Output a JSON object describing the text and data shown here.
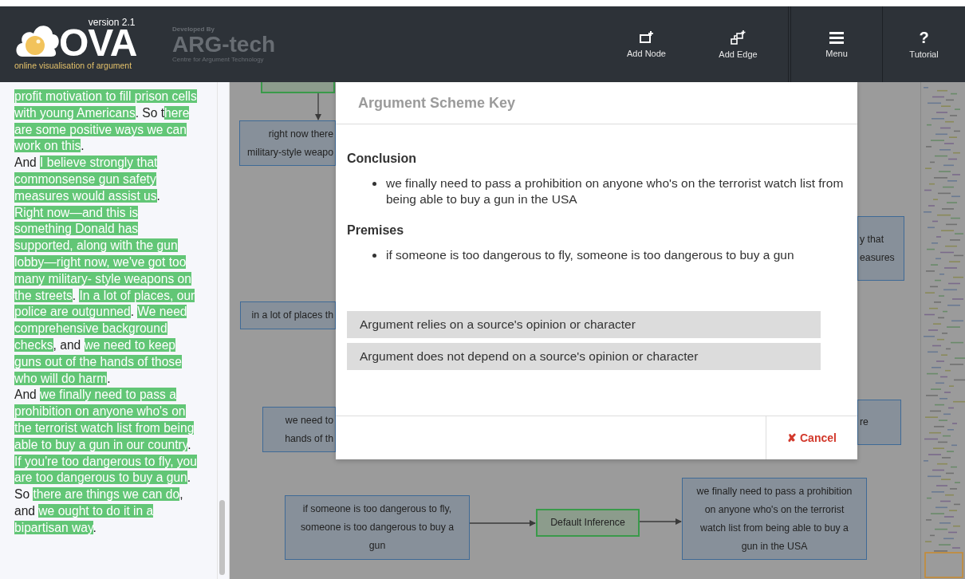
{
  "header": {
    "version": "version 2.1",
    "logo_text": "OVA",
    "tagline": "online visualisation of argument",
    "developer": {
      "label": "Developed By",
      "name": "ARG-tech",
      "subtitle": "Centre for Argument Technology"
    },
    "actions": [
      {
        "kind": "add-node",
        "label": "Add Node"
      },
      {
        "kind": "add-edge",
        "label": "Add Edge"
      },
      {
        "kind": "menu",
        "label": "Menu"
      },
      {
        "kind": "tutorial",
        "label": "Tutorial",
        "glyph": "?"
      }
    ]
  },
  "transcript": {
    "segments": [
      {
        "text": "profit motivation to fill prison cells with young Americans",
        "highlighted": true
      },
      {
        "text": ". So t",
        "highlighted": false
      },
      {
        "text": "here are some positive ways we can work on this",
        "highlighted": true
      },
      {
        "text": ".\nAnd ",
        "highlighted": false
      },
      {
        "text": "I believe strongly that commonsense gun safety measures would assist us",
        "highlighted": true
      },
      {
        "text": ".\n",
        "highlighted": false
      },
      {
        "text": "Right now—and this is something Donald has supported, along with the gun lobby—right now, we've got too many military- style weapons on the streets",
        "highlighted": true
      },
      {
        "text": ". ",
        "highlighted": false
      },
      {
        "text": "In a lot of places, our police are outgunned",
        "highlighted": true
      },
      {
        "text": ". ",
        "highlighted": false
      },
      {
        "text": "We need comprehensive background checks",
        "highlighted": true
      },
      {
        "text": ", and ",
        "highlighted": false
      },
      {
        "text": "we need to keep guns out of the hands of those who will do harm",
        "highlighted": true
      },
      {
        "text": ".\nAnd ",
        "highlighted": false
      },
      {
        "text": "we finally need to pass a prohibition on anyone who's on the terrorist watch list from being able to buy a gun in our country",
        "highlighted": true
      },
      {
        "text": ". ",
        "highlighted": false
      },
      {
        "text": "If you're too dangerous to fly, you are too dangerous to buy a gun",
        "highlighted": true
      },
      {
        "text": ". So ",
        "highlighted": false
      },
      {
        "text": "there are things we can do",
        "highlighted": true
      },
      {
        "text": ", and ",
        "highlighted": false
      },
      {
        "text": "we ought to do it in a bipartisan way",
        "highlighted": true
      },
      {
        "text": ".",
        "highlighted": false
      }
    ]
  },
  "canvas": {
    "nodes": [
      {
        "kind": "inference"
      },
      {
        "kind": "information",
        "lines": [
          "right now there",
          "military-style weapo"
        ]
      },
      {
        "kind": "information",
        "lines": [
          "in a lot of places th"
        ]
      },
      {
        "kind": "information",
        "lines": [
          "we need to",
          "hands of th"
        ]
      },
      {
        "kind": "information",
        "lines": [
          "y that",
          "easures"
        ]
      },
      {
        "kind": "information",
        "lines": [
          "re"
        ]
      },
      {
        "kind": "information",
        "lines": [
          "if someone is too dangerous to fly,",
          "someone is too dangerous to buy a",
          "gun"
        ]
      },
      {
        "kind": "inference",
        "lines": [
          "Default Inference"
        ]
      },
      {
        "kind": "information",
        "lines": [
          "we finally need to pass a prohibition",
          "on anyone who's on the terrorist",
          "watch list from being able to buy a",
          "gun in the USA"
        ]
      }
    ]
  },
  "dialog": {
    "title": "Argument Scheme Key",
    "sections": [
      {
        "heading": "Conclusion",
        "items": [
          "we finally need to pass a prohibition on anyone who's on the terrorist watch list from being able to buy a gun in the USA"
        ]
      },
      {
        "heading": "Premises",
        "items": [
          "if someone is too dangerous to fly, someone is too dangerous to buy a gun"
        ]
      }
    ],
    "options": [
      "Argument relies on a source's opinion or character",
      "Argument does not depend on a source's opinion or character"
    ],
    "cancel": {
      "icon": "✘",
      "label": "Cancel"
    }
  }
}
